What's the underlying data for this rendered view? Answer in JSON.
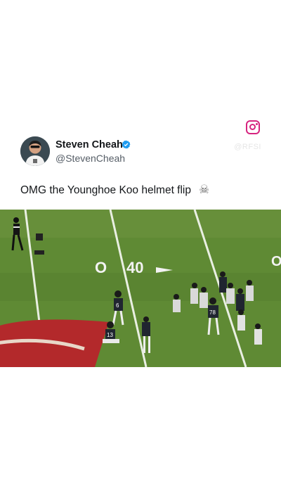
{
  "post": {
    "author_name": "Steven Cheah",
    "author_handle": "@StevenCheah",
    "verified": true,
    "caption": "OMG the Younghoe Koo helmet flip",
    "caption_emoji": "☠"
  },
  "brand": {
    "icon": "instagram-icon",
    "watermark_text": "@RFSI"
  },
  "video": {
    "yard_line": "40",
    "jerseys": [
      "6",
      "13",
      "78"
    ]
  },
  "colors": {
    "instagram": "#d6247f",
    "verified": "#1d9bf0",
    "field": "#5f8a34",
    "endzone_logo": "#b3292b"
  }
}
